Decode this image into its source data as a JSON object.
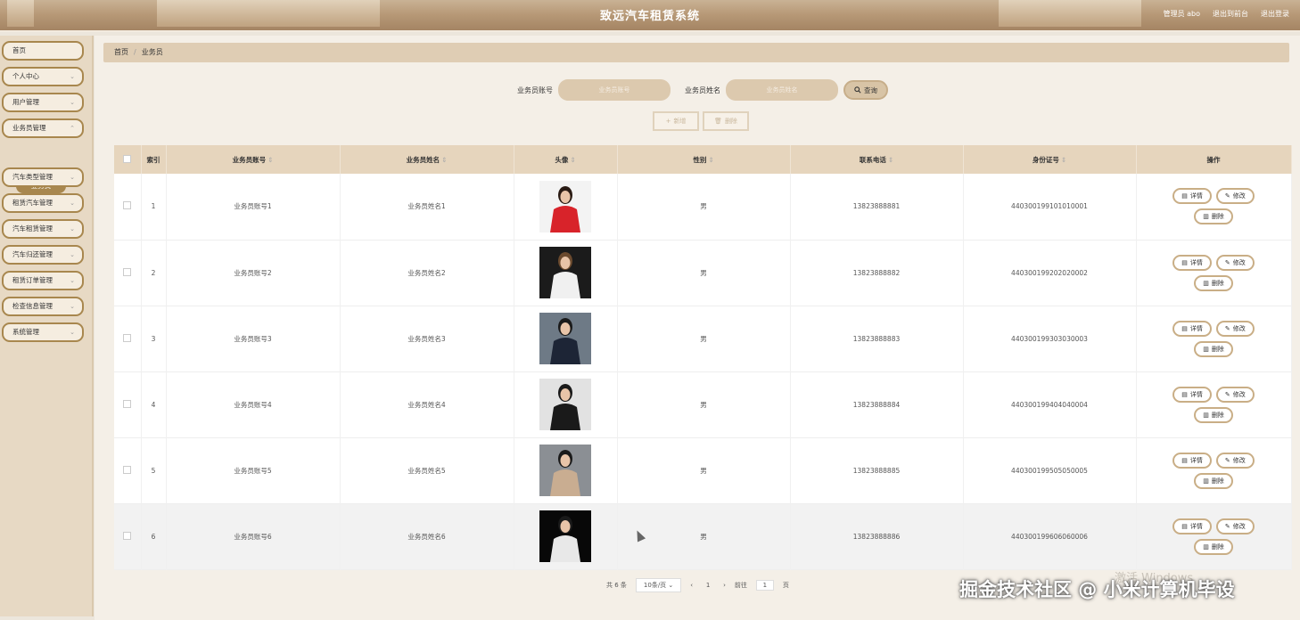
{
  "header": {
    "title": "致远汽车租赁系统",
    "user_label": "管理员 abo",
    "front_link": "退出到前台",
    "logout": "退出登录"
  },
  "sidebar": {
    "items": [
      {
        "label": "首页",
        "chevron": false
      },
      {
        "label": "个人中心",
        "chevron": true
      },
      {
        "label": "用户管理",
        "chevron": true
      },
      {
        "label": "业务员管理",
        "chevron": true
      },
      {
        "label": "汽车类型管理",
        "chevron": true
      },
      {
        "label": "租赁汽车管理",
        "chevron": true
      },
      {
        "label": "汽车租赁管理",
        "chevron": true
      },
      {
        "label": "汽车归还管理",
        "chevron": true
      },
      {
        "label": "租赁订单管理",
        "chevron": true
      },
      {
        "label": "检查信息管理",
        "chevron": true
      },
      {
        "label": "系统管理",
        "chevron": true
      }
    ],
    "active_sub": "业务员"
  },
  "breadcrumb": {
    "home": "首页",
    "current": "业务员"
  },
  "search": {
    "account_label": "业务员账号",
    "account_placeholder": "业务员账号",
    "name_label": "业务员姓名",
    "name_placeholder": "业务员姓名",
    "button": "查询"
  },
  "actions": {
    "add": "新增",
    "delete": "删除"
  },
  "table": {
    "headers": [
      "索引",
      "业务员账号",
      "业务员姓名",
      "头像",
      "性别",
      "联系电话",
      "身份证号",
      "操作"
    ],
    "rows": [
      {
        "index": "1",
        "account": "业务员账号1",
        "name": "业务员姓名1",
        "gender": "男",
        "phone": "13823888881",
        "id_card": "440300199101010001",
        "avatar": "woman-red-dress"
      },
      {
        "index": "2",
        "account": "业务员账号2",
        "name": "业务员姓名2",
        "gender": "男",
        "phone": "13823888882",
        "id_card": "440300199202020002",
        "avatar": "woman-white-outfit"
      },
      {
        "index": "3",
        "account": "业务员账号3",
        "name": "业务员姓名3",
        "gender": "男",
        "phone": "13823888883",
        "id_card": "440300199303030003",
        "avatar": "man-dark-suit"
      },
      {
        "index": "4",
        "account": "业务员账号4",
        "name": "业务员姓名4",
        "gender": "男",
        "phone": "13823888884",
        "id_card": "440300199404040004",
        "avatar": "woman-black-dress"
      },
      {
        "index": "5",
        "account": "业务员账号5",
        "name": "业务员姓名5",
        "gender": "男",
        "phone": "13823888885",
        "id_card": "440300199505050005",
        "avatar": "man-beige-suit"
      },
      {
        "index": "6",
        "account": "业务员账号6",
        "name": "业务员姓名6",
        "gender": "男",
        "phone": "13823888886",
        "id_card": "440300199606060006",
        "avatar": "man-white-suit"
      }
    ],
    "op_detail": "详情",
    "op_edit": "修改",
    "op_delete": "删除"
  },
  "pager": {
    "total": "共 6 条",
    "page_size": "10条/页",
    "prev": "‹",
    "page": "1",
    "next": "›",
    "goto": "前往",
    "goto_value": "1",
    "page_unit": "页"
  },
  "overlay": {
    "windows_text": "激活 Windows",
    "watermark": "掘金技术社区 @ 小米计算机毕设"
  },
  "colors": {
    "accent": "#a8874e",
    "header_bg": "#e6d5bd",
    "sidebar_bg": "#e7d9c4"
  }
}
